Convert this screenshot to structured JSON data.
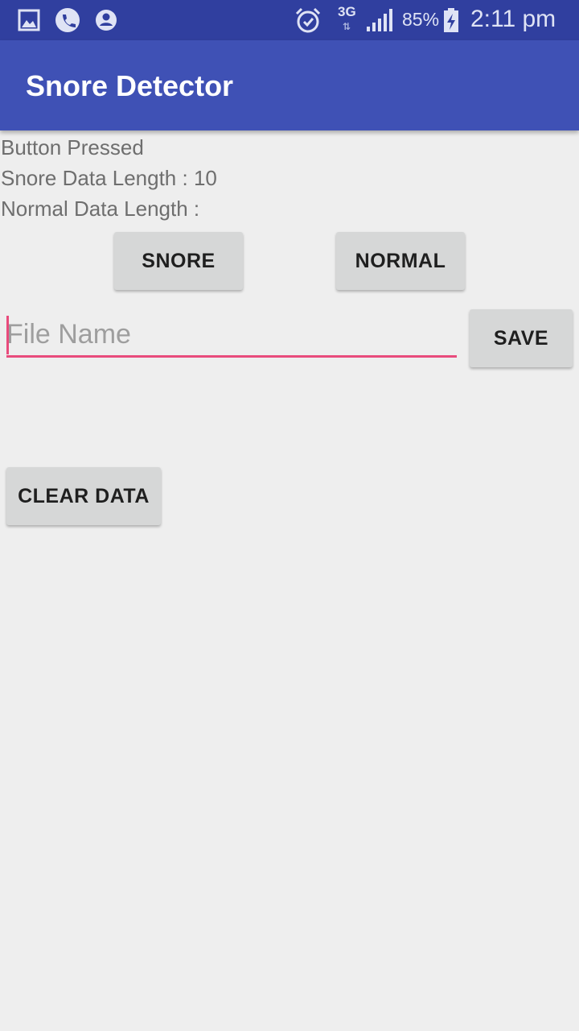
{
  "status_bar": {
    "network": "3G",
    "battery_percent": "85%",
    "time": "2:11 pm",
    "icons": [
      "gallery-icon",
      "phone-icon",
      "account-icon",
      "alarm-icon",
      "signal-icon",
      "battery-charging-icon"
    ]
  },
  "app_bar": {
    "title": "Snore Detector"
  },
  "info": {
    "button_pressed": "Button Pressed",
    "snore_length": "Snore Data Length : 10",
    "normal_length": "Normal Data Length :"
  },
  "buttons": {
    "snore": "SNORE",
    "normal": "NORMAL",
    "save": "SAVE",
    "clear": "CLEAR DATA"
  },
  "file_name": {
    "placeholder": "File Name",
    "value": ""
  },
  "colors": {
    "status_bar": "#303f9f",
    "app_bar": "#3f51b5",
    "accent": "#e84b7c",
    "background": "#eeeeee",
    "button": "#d6d7d7"
  }
}
